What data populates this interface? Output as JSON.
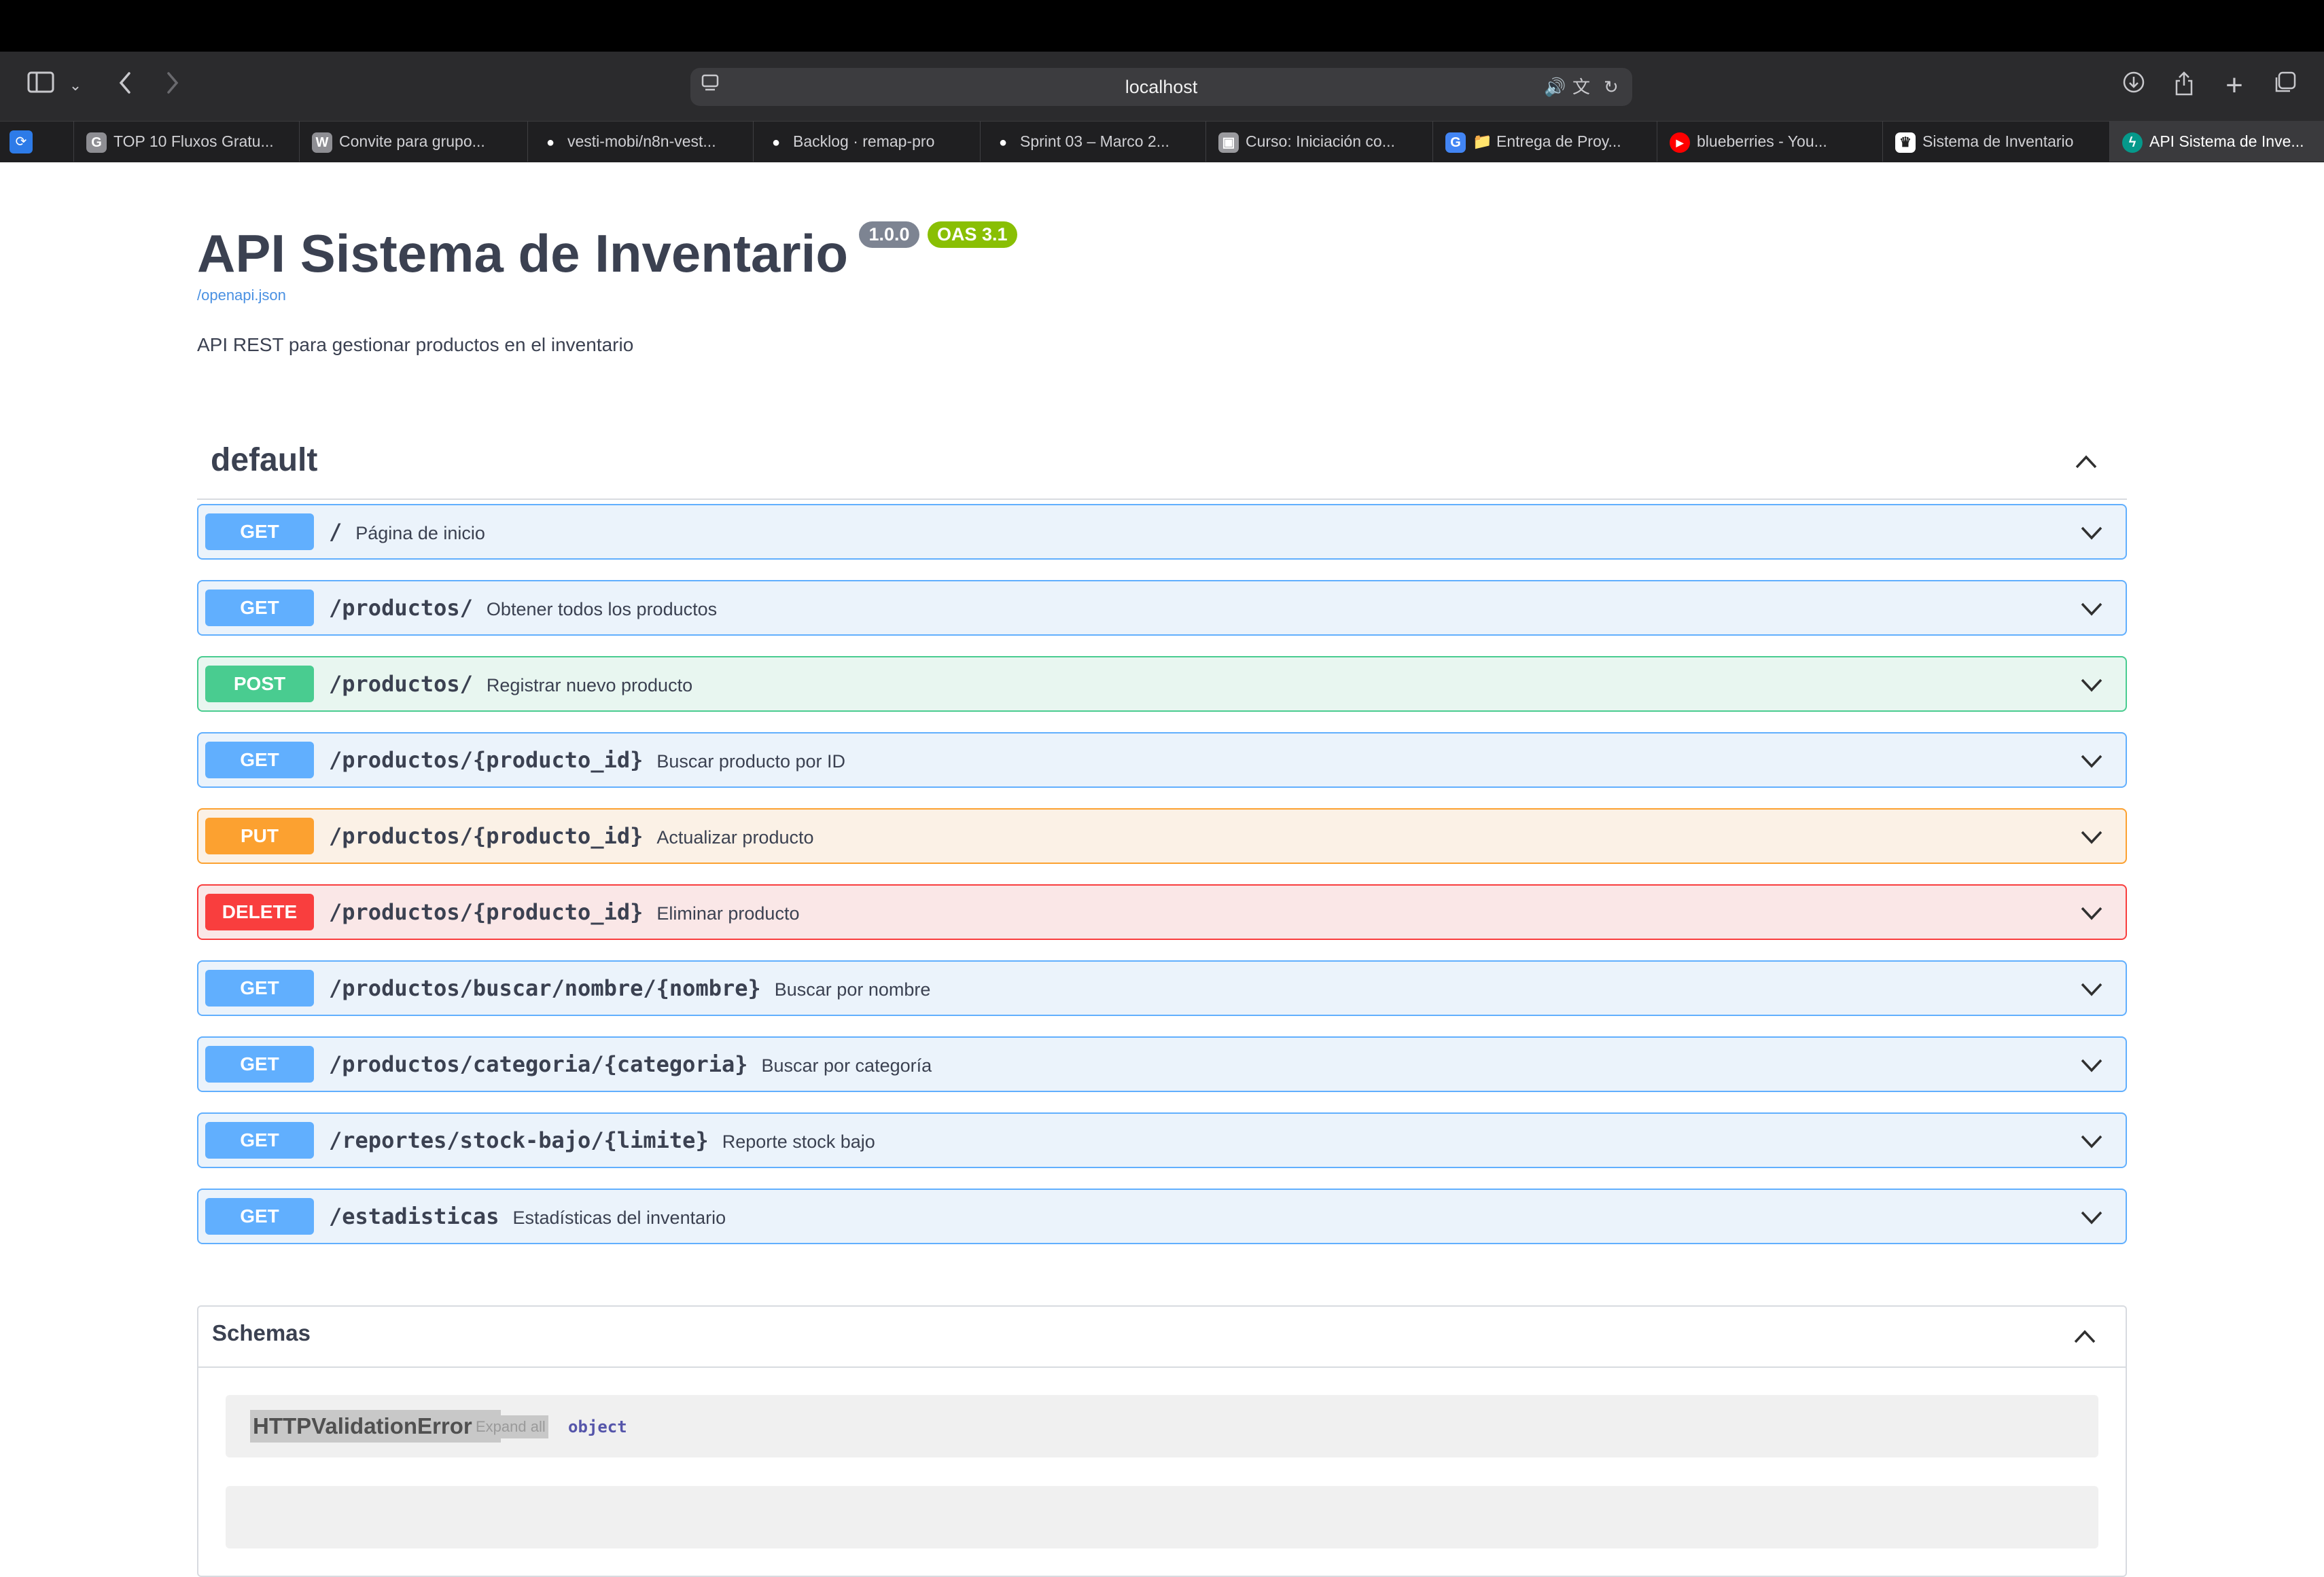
{
  "browser": {
    "url": "localhost",
    "tabs": [
      {
        "label": "TOP 10 Fluxos Gratu...",
        "favicon": "G",
        "color": "#8e8e93"
      },
      {
        "label": "Convite para grupo...",
        "favicon": "W",
        "color": "#8e8e93"
      },
      {
        "label": "vesti-mobi/n8n-vest...",
        "favicon": "github-icon",
        "color": "#ffffff"
      },
      {
        "label": "Backlog · remap-pro",
        "favicon": "github-icon",
        "color": "#ffffff"
      },
      {
        "label": "Sprint 03 – Marco 2...",
        "favicon": "github-icon",
        "color": "#ffffff"
      },
      {
        "label": "Curso: Iniciación co...",
        "favicon": "image-icon",
        "color": "#9a9a9e"
      },
      {
        "label": "📁 Entrega de Proy...",
        "favicon": "G",
        "color": "#4285f4"
      },
      {
        "label": "blueberries - You...",
        "favicon": "youtube-icon",
        "color": "#ff0000"
      },
      {
        "label": "Sistema de Inventario",
        "favicon": "crown-icon",
        "color": "#ffffff"
      },
      {
        "label": "API Sistema de Inve...",
        "favicon": "fastapi-icon",
        "color": "#05998b",
        "active": true
      }
    ]
  },
  "info": {
    "title": "API Sistema de Inventario",
    "version": "1.0.0",
    "oas": "OAS 3.1",
    "spec_link": "/openapi.json",
    "description": "API REST para gestionar productos en el inventario"
  },
  "tag": {
    "name": "default"
  },
  "operations": [
    {
      "method": "GET",
      "path": "/",
      "summary": "Página de inicio"
    },
    {
      "method": "GET",
      "path": "/productos/",
      "summary": "Obtener todos los productos"
    },
    {
      "method": "POST",
      "path": "/productos/",
      "summary": "Registrar nuevo producto"
    },
    {
      "method": "GET",
      "path": "/productos/{producto_id}",
      "summary": "Buscar producto por ID"
    },
    {
      "method": "PUT",
      "path": "/productos/{producto_id}",
      "summary": "Actualizar producto"
    },
    {
      "method": "DELETE",
      "path": "/productos/{producto_id}",
      "summary": "Eliminar producto"
    },
    {
      "method": "GET",
      "path": "/productos/buscar/nombre/{nombre}",
      "summary": "Buscar por nombre"
    },
    {
      "method": "GET",
      "path": "/productos/categoria/{categoria}",
      "summary": "Buscar por categoría"
    },
    {
      "method": "GET",
      "path": "/reportes/stock-bajo/{limite}",
      "summary": "Reporte stock bajo"
    },
    {
      "method": "GET",
      "path": "/estadisticas",
      "summary": "Estadísticas del inventario"
    }
  ],
  "schemas": {
    "title": "Schemas",
    "models": [
      {
        "name": "HTTPValidationError",
        "expand_label": "Expand all",
        "type": "object"
      }
    ]
  },
  "colors": {
    "get": "#61affe",
    "post": "#49cc90",
    "put": "#fca130",
    "delete": "#f93e3e"
  }
}
